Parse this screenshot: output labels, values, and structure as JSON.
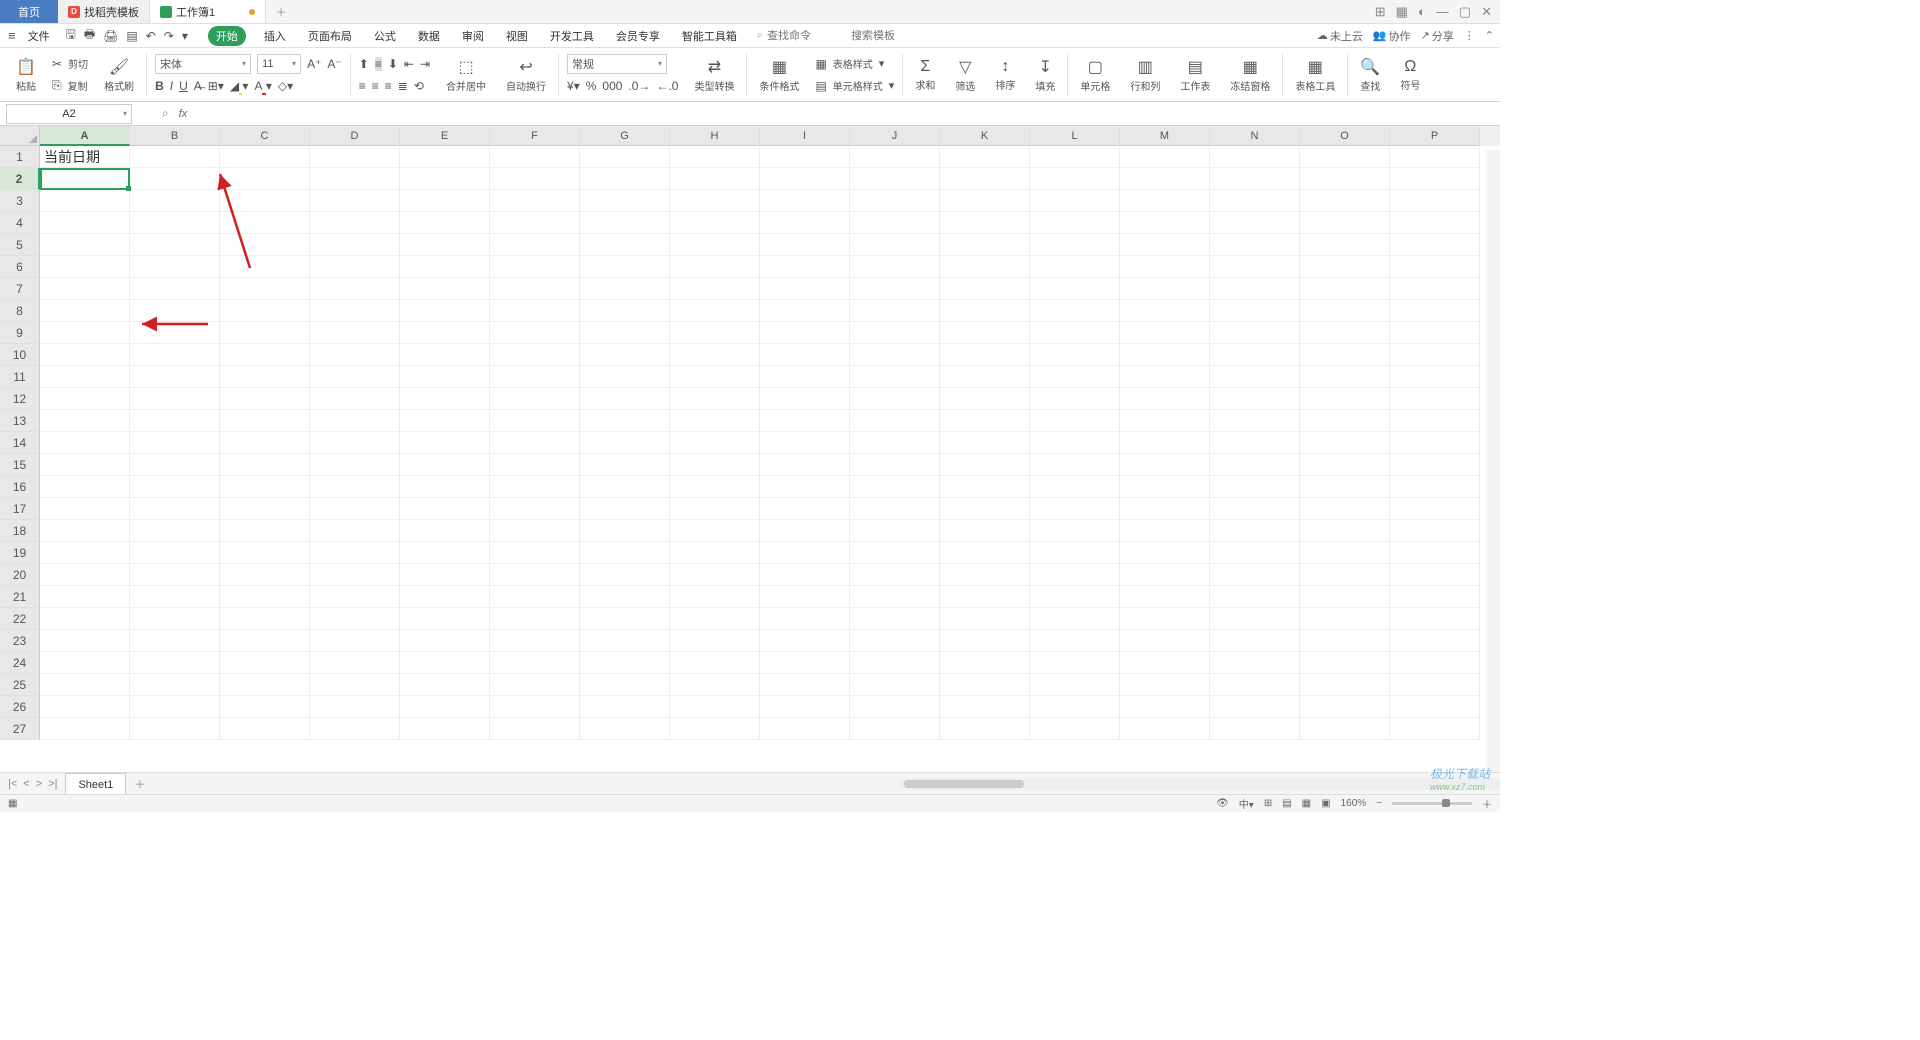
{
  "tabs": {
    "home": "首页",
    "t1": "找稻壳模板",
    "t2": "工作簿1"
  },
  "window": {
    "layout": "⊞",
    "grid": "▦",
    "user": "◐",
    "min": "—",
    "max": "▢",
    "close": "✕"
  },
  "file_label": "文件",
  "qat": {
    "save": "🖫",
    "saveas": "🖶",
    "print": "🖨",
    "preview": "▤",
    "undo": "↶",
    "redo": "↷",
    "more": "▾"
  },
  "menu": [
    "开始",
    "插入",
    "页面布局",
    "公式",
    "数据",
    "审阅",
    "视图",
    "开发工具",
    "会员专享",
    "智能工具箱"
  ],
  "menu_active_index": 0,
  "search": {
    "icon": "⌕",
    "placeholder1": "查找命令",
    "placeholder2": "搜索模板"
  },
  "menu_right": {
    "cloud": "未上云",
    "collab": "协作",
    "share": "分享"
  },
  "ribbon": {
    "paste": "粘贴",
    "cut": "剪切",
    "copy": "复制",
    "format_painter": "格式刷",
    "font_name": "宋体",
    "font_size": "11",
    "merge": "合并居中",
    "wrap": "自动换行",
    "number_format": "常规",
    "type_convert": "类型转换",
    "cond_fmt": "条件格式",
    "table_style": "表格样式",
    "cell_style": "单元格样式",
    "sum": "求和",
    "filter": "筛选",
    "sort": "排序",
    "fill": "填充",
    "cell": "单元格",
    "rowcol": "行和列",
    "worksheet": "工作表",
    "freeze": "冻结窗格",
    "table_tools": "表格工具",
    "find": "查找",
    "symbol": "符号"
  },
  "name_box": "A2",
  "fx_label": "fx",
  "columns": [
    "A",
    "B",
    "C",
    "D",
    "E",
    "F",
    "G",
    "H",
    "I",
    "J",
    "K",
    "L",
    "M",
    "N",
    "O",
    "P"
  ],
  "rows_count": 27,
  "cell_A1": "当前日期",
  "selected": {
    "col": "A",
    "row": 2
  },
  "sheet": {
    "name": "Sheet1"
  },
  "status": {
    "ready": "▦",
    "views": [
      "⊞",
      "▤",
      "▦",
      "▣"
    ],
    "zoom": "160%"
  },
  "watermark": {
    "title": "极光下载站",
    "sub": "www.xz7.com"
  }
}
